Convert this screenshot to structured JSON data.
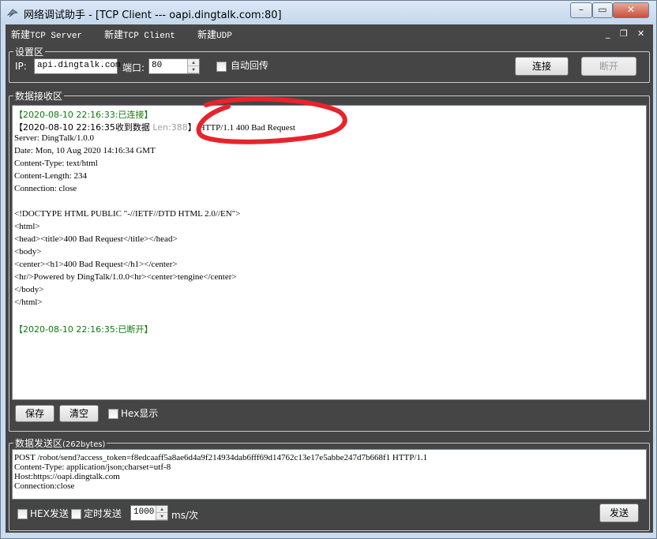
{
  "window": {
    "title": "网络调试助手 - [TCP Client --- oapi.dingtalk.com:80]",
    "minimize": "–",
    "restore": "▭",
    "close": "✕"
  },
  "menu": {
    "new_tcp_server_prefix": "新建",
    "new_tcp_server_suffix": "TCP Server",
    "new_tcp_client_prefix": "新建",
    "new_tcp_client_suffix": "TCP Client",
    "new_udp_prefix": "新建",
    "new_udp_suffix": "UDP",
    "mdi_minimize": "_",
    "mdi_restore": "❐",
    "mdi_close": "✕"
  },
  "settings": {
    "legend": "设置区",
    "ip_label": "IP:",
    "ip_value": "api.dingtalk.com",
    "port_label": "端口:",
    "port_value": "80",
    "auto_reply_label": "自动回传",
    "connect_label": "连接",
    "disconnect_label": "断开"
  },
  "receive": {
    "legend": "数据接收区",
    "line1": "【2020-08-10 22:16:33:已连接】",
    "line2_a": "【2020-08-10 22:16:35收到数据 ",
    "line2_len": "Len:388",
    "line2_b": "】:HTTP/1.1 400 Bad Request",
    "lines": [
      "Server: DingTalk/1.0.0",
      "Date: Mon, 10 Aug 2020 14:16:34 GMT",
      "Content-Type: text/html",
      "Content-Length: 234",
      "Connection: close",
      "",
      "<!DOCTYPE HTML PUBLIC \"-//IETF//DTD HTML 2.0//EN\">",
      "<html>",
      "<head><title>400 Bad Request</title></head>",
      "<body>",
      "<center><h1>400 Bad Request</h1></center>",
      "<hr/>Powered by DingTalk/1.0.0<hr><center>tengine</center>",
      "</body>",
      "</html>"
    ],
    "line_last": "【2020-08-10 22:16:35:已断开】",
    "save_label": "保存",
    "clear_label": "清空",
    "hex_display_label": "Hex显示"
  },
  "send": {
    "legend": "数据发送区",
    "bytes": "(262bytes)",
    "lines": [
      "POST /robot/send?access_token=f8edcaaff5a8ae6d4a9f214934dab6fff69d14762c13e17e5abbe247d7b668f1 HTTP/1.1",
      "Content-Type: application/json;charset=utf-8",
      "Host:https://oapi.dingtalk.com",
      "Connection:close"
    ],
    "hex_send_label": "HEX发送",
    "timed_send_label": "定时发送",
    "interval_value": "1000",
    "interval_unit": "ms/次",
    "send_label": "发送"
  },
  "colors": {
    "annotation": "#e8232b",
    "status_green": "#0d7a0d"
  }
}
